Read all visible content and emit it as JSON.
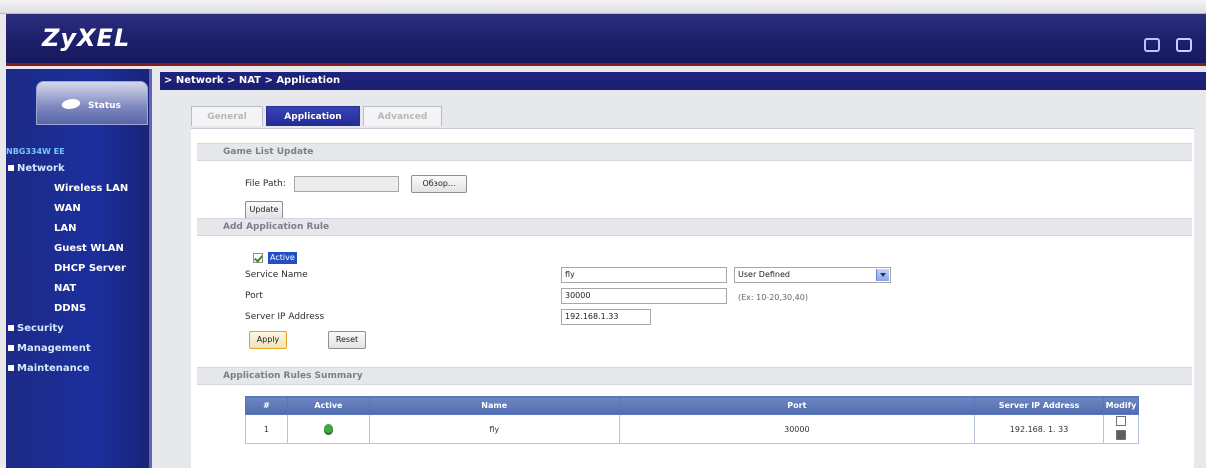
{
  "header": {
    "logo": "ZyXEL",
    "icons": [
      "help-icon",
      "logout-icon"
    ]
  },
  "sidebar": {
    "status_label": "Status",
    "model": "NBG334W EE",
    "sections": [
      {
        "label": "Network",
        "items": [
          "Wireless LAN",
          "WAN",
          "LAN",
          "Guest WLAN",
          "DHCP Server",
          "NAT",
          "DDNS"
        ]
      },
      {
        "label": "Security",
        "items": []
      },
      {
        "label": "Management",
        "items": []
      },
      {
        "label": "Maintenance",
        "items": []
      }
    ]
  },
  "breadcrumb": "> Network > NAT > Application",
  "tabs": [
    {
      "label": "General"
    },
    {
      "label": "Application"
    },
    {
      "label": "Advanced"
    }
  ],
  "game_list": {
    "title": "Game List Update",
    "file_path_label": "File Path:",
    "file_path_value": "",
    "browse_button": "Обзор...",
    "update_button": "Update"
  },
  "add_rule": {
    "title": "Add Application Rule",
    "active_label": "Active",
    "service_name_label": "Service Name",
    "service_name_value": "fly",
    "service_type_value": "User Defined",
    "port_label": "Port",
    "port_value": "30000",
    "port_hint": "(Ex: 10-20,30,40)",
    "server_ip_label": "Server IP Address",
    "server_ip_value": "192.168.1.33",
    "apply_button": "Apply",
    "reset_button": "Reset"
  },
  "summary": {
    "title": "Application Rules Summary",
    "columns": [
      "#",
      "Active",
      "Name",
      "Port",
      "Server IP Address",
      "Modify"
    ],
    "rows": [
      {
        "index": "1",
        "name": "fly",
        "port": "30000",
        "server_ip": "192.168. 1. 33"
      }
    ]
  }
}
